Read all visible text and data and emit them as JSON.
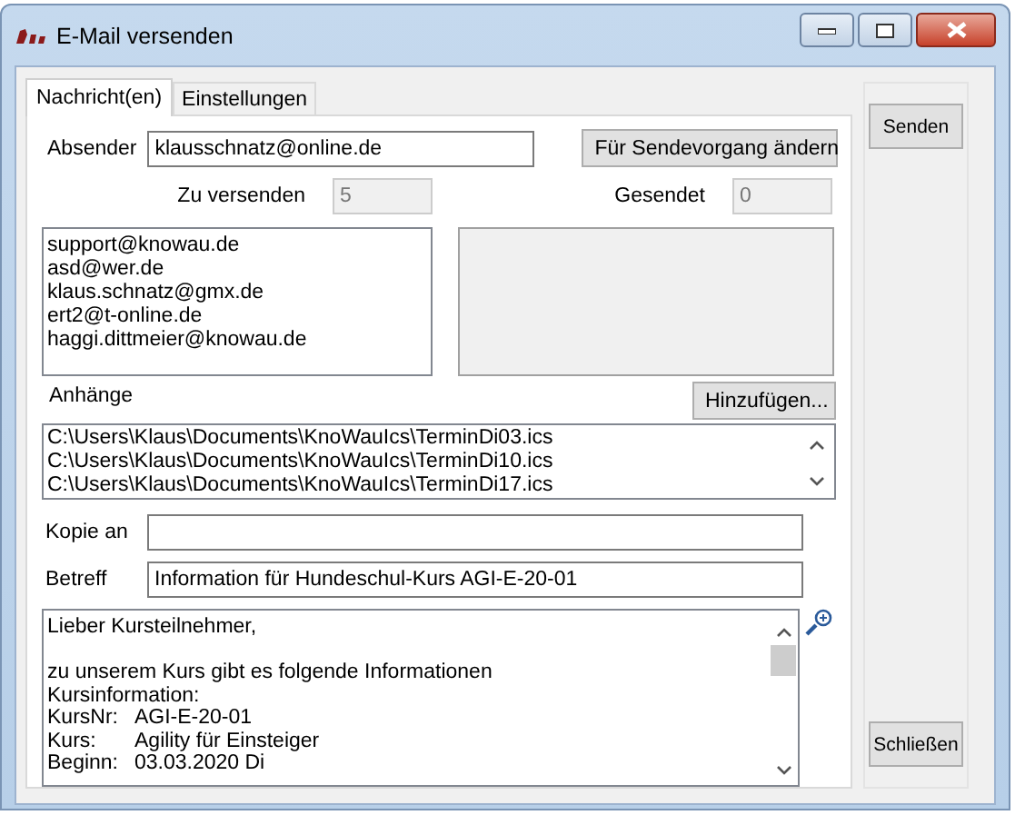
{
  "window": {
    "title": "E-Mail versenden"
  },
  "tabs": [
    {
      "label": "Nachricht(en)",
      "selected": true
    },
    {
      "label": "Einstellungen",
      "selected": false
    }
  ],
  "sender": {
    "label": "Absender",
    "value": "klausschnatz@online.de",
    "button": "Für Sendevorgang ändern"
  },
  "to_send": {
    "label": "Zu versenden",
    "value": "5"
  },
  "sent": {
    "label": "Gesendet",
    "value": "0"
  },
  "recipients": [
    "support@knowau.de",
    "asd@wer.de",
    "klaus.schnatz@gmx.de",
    "ert2@t-online.de",
    "haggi.dittmeier@knowau.de"
  ],
  "attachments": {
    "label": "Anhänge",
    "button": "Hinzufügen...",
    "items": [
      "C:\\Users\\Klaus\\Documents\\KnoWauIcs\\TerminDi03.ics",
      "C:\\Users\\Klaus\\Documents\\KnoWauIcs\\TerminDi10.ics",
      "C:\\Users\\Klaus\\Documents\\KnoWauIcs\\TerminDi17.ics"
    ]
  },
  "cc": {
    "label": "Kopie an"
  },
  "subject": {
    "label": "Betreff",
    "value": "Information für Hundeschul-Kurs AGI-E-20-01"
  },
  "body": [
    {
      "kind": "text",
      "text": "Lieber Kursteilnehmer,"
    },
    {
      "kind": "blank"
    },
    {
      "kind": "text",
      "text": "zu unserem Kurs gibt es folgende Informationen"
    },
    {
      "kind": "text",
      "text": "Kursinformation:"
    },
    {
      "kind": "pair",
      "key": "KursNr:",
      "value": "AGI-E-20-01"
    },
    {
      "kind": "pair",
      "key": "Kurs:",
      "value": "Agility für Einsteiger"
    },
    {
      "kind": "pair",
      "key": "Beginn:",
      "value": "03.03.2020 Di"
    }
  ],
  "buttons": {
    "send": "Senden",
    "close": "Schließen"
  }
}
